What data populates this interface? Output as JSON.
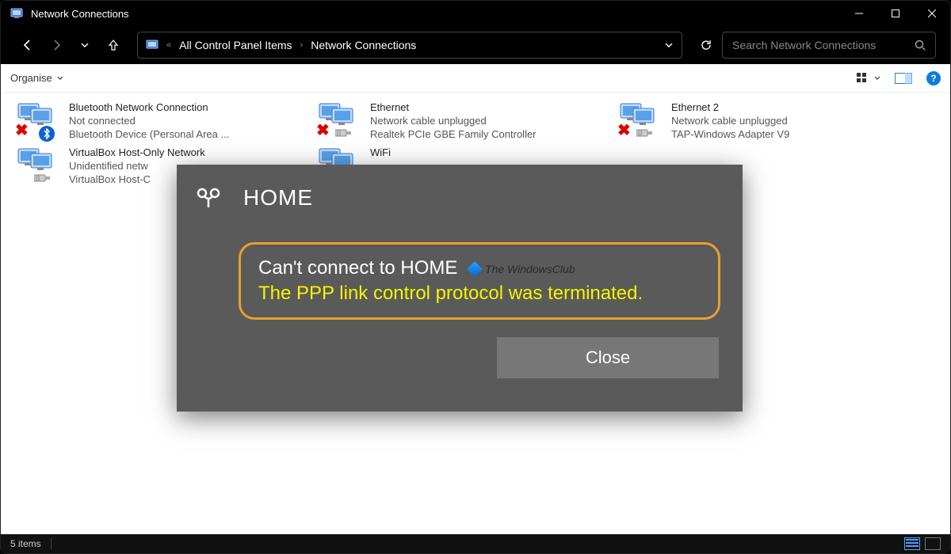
{
  "window": {
    "title": "Network Connections"
  },
  "nav": {
    "crumb_parent": "All Control Panel Items",
    "crumb_current": "Network Connections",
    "search_placeholder": "Search Network Connections"
  },
  "toolbar": {
    "organise": "Organise"
  },
  "items": [
    {
      "name": "Bluetooth Network Connection",
      "status": "Not connected",
      "device": "Bluetooth Device (Personal Area ...",
      "badge": "bluetooth",
      "cross": true
    },
    {
      "name": "Ethernet",
      "status": "Network cable unplugged",
      "device": "Realtek PCIe GBE Family Controller",
      "badge": "plug",
      "cross": true
    },
    {
      "name": "Ethernet 2",
      "status": "Network cable unplugged",
      "device": "TAP-Windows Adapter V9",
      "badge": "plug",
      "cross": true
    },
    {
      "name": "VirtualBox Host-Only Network",
      "status": "Unidentified netw",
      "device": "VirtualBox Host-C",
      "badge": "plug",
      "cross": false
    },
    {
      "name": "WiFi",
      "status": "",
      "device": "",
      "badge": "plug",
      "cross": false
    }
  ],
  "modal": {
    "title": "HOME",
    "line1": "Can't connect to HOME",
    "line2": "The PPP link control protocol was terminated.",
    "watermark": "The WindowsClub",
    "close": "Close"
  },
  "statusbar": {
    "count": "5 items"
  }
}
